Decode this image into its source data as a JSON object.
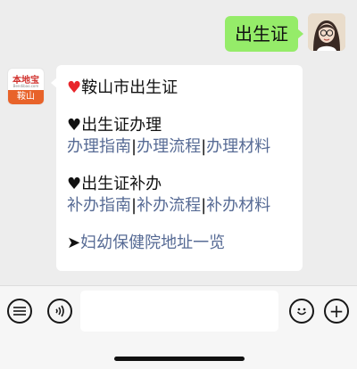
{
  "outgoing_message": "出生证",
  "bot": {
    "brand": "本地宝",
    "brand_sub": "Bendibao.com",
    "city": "鞍山"
  },
  "reply": {
    "title_icon": "♥",
    "title": "鞍山市出生证",
    "section1": {
      "icon": "♥",
      "heading": "出生证办理",
      "links": [
        "办理指南",
        "办理流程",
        "办理材料"
      ]
    },
    "section2": {
      "icon": "♥",
      "heading": "出生证补办",
      "links": [
        "补办指南",
        "补办流程",
        "补办材料"
      ]
    },
    "separator": "|",
    "arrow": "➤",
    "footer_link": "妇幼保健院地址一览"
  },
  "input_bar": {
    "icons": [
      "list-icon",
      "voice-icon",
      "emoji-icon",
      "plus-icon"
    ],
    "plus": "+"
  }
}
